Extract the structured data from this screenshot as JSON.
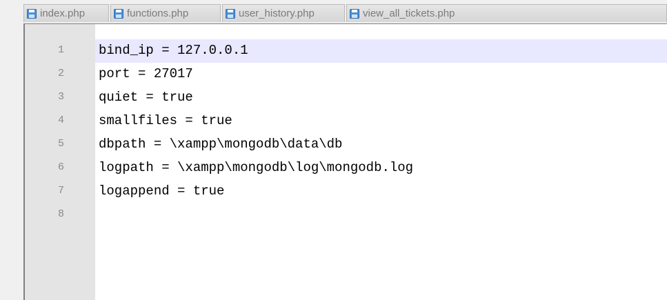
{
  "tabs": [
    {
      "label": "index.php",
      "icon": "save-icon"
    },
    {
      "label": "functions.php",
      "icon": "save-icon"
    },
    {
      "label": "user_history.php",
      "icon": "save-icon"
    },
    {
      "label": "view_all_tickets.php",
      "icon": "save-icon"
    }
  ],
  "editor": {
    "current_line": 1,
    "lines": [
      {
        "number": "1",
        "text": "bind_ip = 127.0.0.1"
      },
      {
        "number": "2",
        "text": "port = 27017"
      },
      {
        "number": "3",
        "text": "quiet = true"
      },
      {
        "number": "4",
        "text": "smallfiles = true"
      },
      {
        "number": "5",
        "text": "dbpath = \\xampp\\mongodb\\data\\db"
      },
      {
        "number": "6",
        "text": "logpath = \\xampp\\mongodb\\log\\mongodb.log"
      },
      {
        "number": "7",
        "text": "logappend = true"
      },
      {
        "number": "8",
        "text": ""
      }
    ]
  },
  "colors": {
    "current_line_highlight": "#e8e8ff",
    "gutter": "#e4e4e4",
    "line_number": "#8a8a8a",
    "save_icon": "#4a90d9"
  }
}
